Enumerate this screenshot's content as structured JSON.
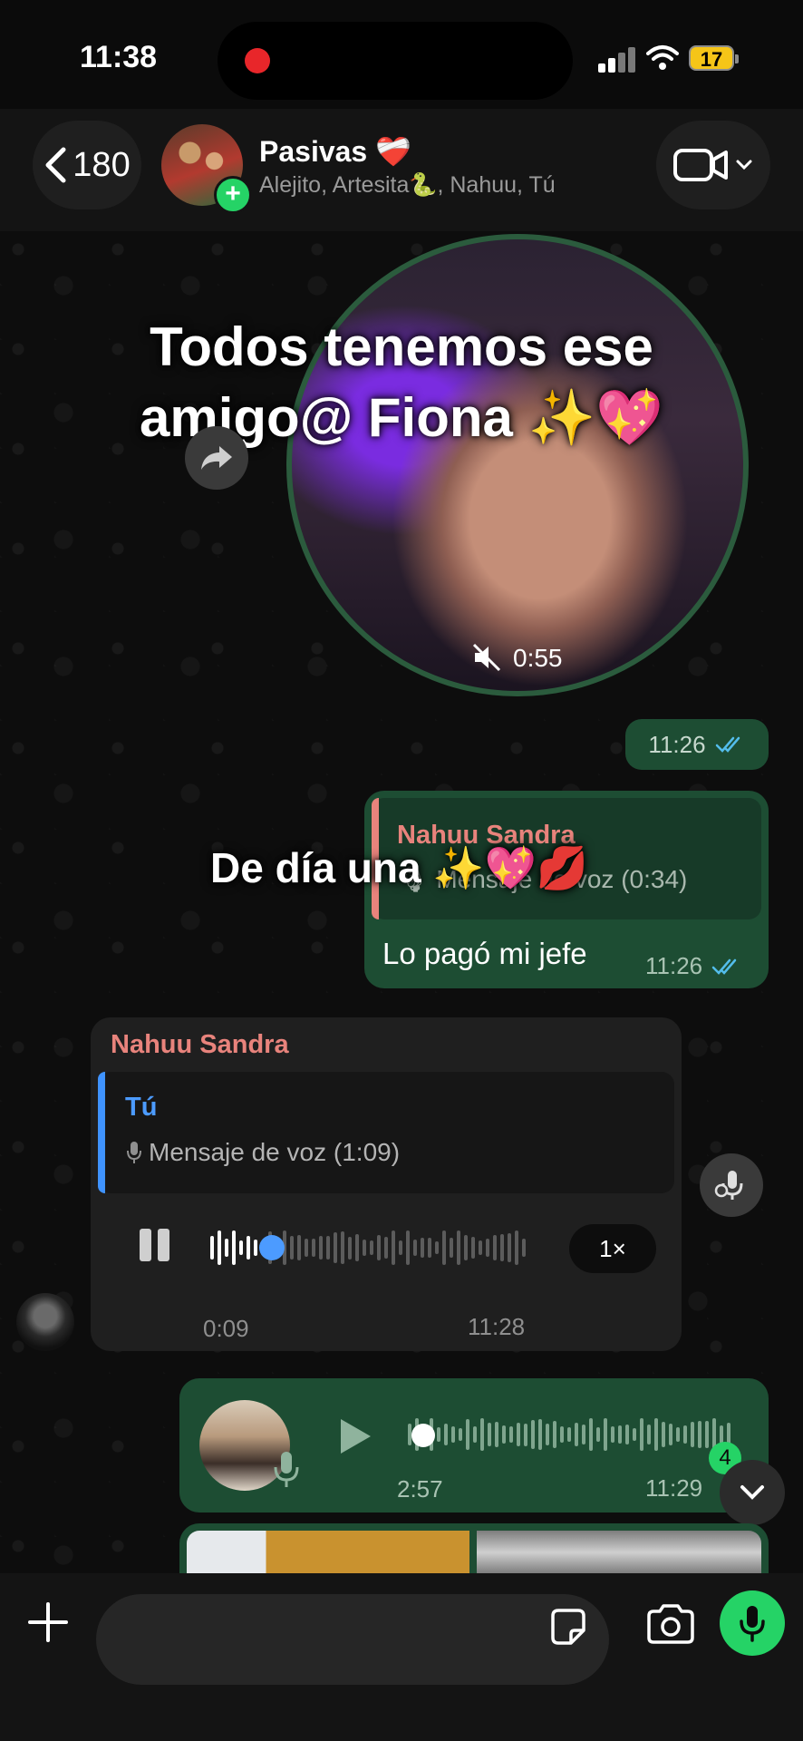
{
  "status_bar": {
    "time": "11:38",
    "battery": "17"
  },
  "header": {
    "back_count": "180",
    "group_name": "Pasivas ❤️‍🩹",
    "members": "Alejito, Artesita🐍, Nahuu, Tú"
  },
  "overlay_captions": {
    "line1": "Todos tenemos ese",
    "line2": "amigo@ Fiona ✨💖",
    "mid": "De día una ✨💖💋"
  },
  "video_message": {
    "duration": "0:55",
    "time": "11:26"
  },
  "reply_message": {
    "quoted_sender": "Nahuu Sandra",
    "quoted_text": "🎙 Mensaje de voz (0:34)",
    "text": "Lo pagó mi jefe",
    "time": "11:26"
  },
  "incoming_voice": {
    "sender": "Nahuu Sandra",
    "quoted_sender": "Tú",
    "quoted_text": "Mensaje de voz (1:09)",
    "elapsed": "0:09",
    "speed": "1×",
    "time": "11:28",
    "progress": 0.09
  },
  "outgoing_voice": {
    "duration": "2:57",
    "time": "11:29",
    "unread_count": "4"
  },
  "composer": {
    "placeholder": ""
  },
  "colors": {
    "outgoing_bubble": "#1d4d33",
    "incoming_bubble": "#1f1f1f",
    "accent_green": "#25d366",
    "sender_name": "#e8837c",
    "quote_blue": "#4c9bff",
    "read_ticks": "#53bdeb"
  },
  "icons": [
    "chevron-left-icon",
    "video-camera-icon",
    "chevron-down-icon",
    "forward-icon",
    "muted-icon",
    "double-check-icon",
    "mic-icon",
    "pause-icon",
    "play-icon",
    "transcribe-icon",
    "plus-icon",
    "sticker-icon",
    "camera-icon"
  ]
}
